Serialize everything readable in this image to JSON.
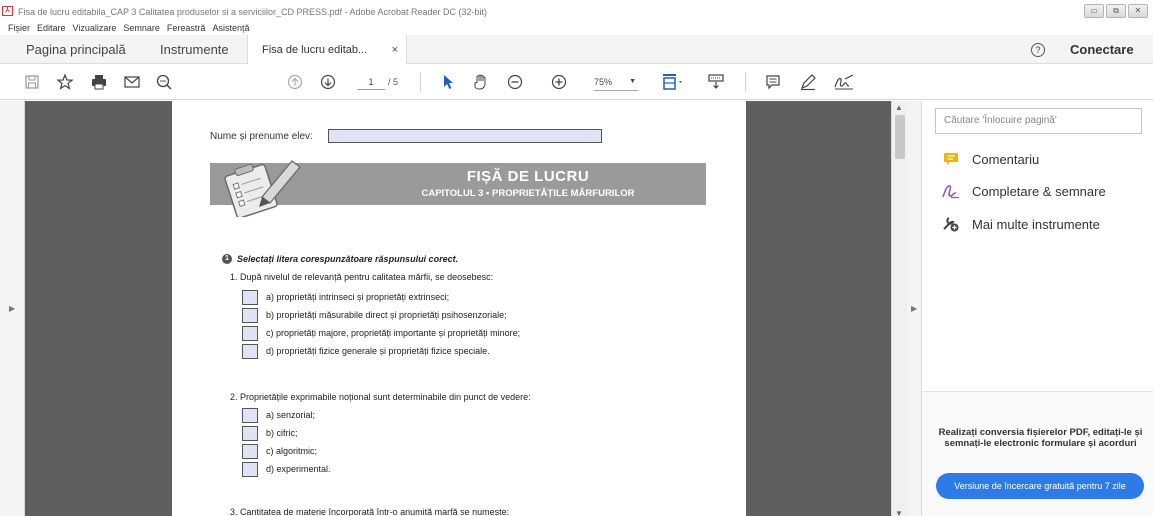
{
  "window": {
    "title": "Fisa de lucru editabila_CAP 3 Calitatea produselor si a serviciilor_CD PRESS.pdf - Adobe Acrobat Reader DC (32-bit)",
    "controls": [
      "minimize",
      "maximize",
      "close"
    ]
  },
  "menu": [
    "Fișier",
    "Editare",
    "Vizualizare",
    "Semnare",
    "Fereastră",
    "Asistență"
  ],
  "tabs": {
    "home": "Pagina principală",
    "tools": "Instrumente",
    "doc": "Fisa de lucru editab...",
    "doc_close": "×"
  },
  "header": {
    "help": "?",
    "connect": "Conectare"
  },
  "toolbar": {
    "icons": [
      "save-icon",
      "bookmark-star-icon",
      "print-icon",
      "email-icon",
      "search-zoom-icon",
      "page-up-icon",
      "page-down-icon",
      "select-arrow-icon",
      "hand-icon",
      "zoom-out-icon",
      "zoom-in-icon",
      "fit-page-icon",
      "scroll-mode-icon",
      "comment-icon",
      "highlight-pen-icon",
      "sign-icon"
    ],
    "page_current": "1",
    "page_total": "/ 5",
    "zoom": "75%",
    "zoom_dropdown": "▼"
  },
  "right_panel": {
    "search_placeholder": "Căutare 'Înlocuire pagină'",
    "items": [
      {
        "label": "Comentariu",
        "icon": "comment-icon",
        "color": "#f5b400"
      },
      {
        "label": "Completare & semnare",
        "icon": "fill-sign-icon",
        "color": "#8a5cc4"
      },
      {
        "label": "Mai multe instrumente",
        "icon": "more-tools-icon",
        "color": "#444444"
      }
    ],
    "promo_text": "Realizați conversia fișierelor PDF, editați-le și semnați-le electronic formulare și acorduri",
    "trial_button": "Versiune de încercare gratuită pentru 7 zile"
  },
  "document": {
    "name_label": "Nume și prenume elev:",
    "banner_title": "FIȘĂ DE LUCRU",
    "banner_subtitle": "CAPITOLUL 3 • PROPRIETĂȚILE MĂRFURILOR",
    "section_number": "1",
    "instruction": "Selectați litera corespunzătoare răspunsului corect.",
    "questions": [
      {
        "text": "1. După nivelul de relevanță pentru calitatea mărfii, se deosebesc:",
        "options": [
          "a) proprietăți intrinseci și proprietăți extrinseci;",
          "b) proprietăți măsurabile direct și proprietăți psihosenzoriale;",
          "c) proprietăți majore, proprietăți importante și proprietăți minore;",
          "d) proprietăți fizice generale și proprietăți fizice speciale."
        ]
      },
      {
        "text": "2. Proprietățile exprimabile noțional sunt determinabile din punct de vedere:",
        "options": [
          "a) senzorial;",
          "b) cifric;",
          "c) algoritmic;",
          "d) experimental."
        ]
      },
      {
        "text": "3. Cantitatea de materie încorporată într-o anumită marfă se numește:",
        "options": []
      }
    ]
  },
  "colors": {
    "doc_background": "#5f5f5f",
    "banner": "#9a9a9a",
    "form_field": "#dfe3f5",
    "accent_blue": "#2d7be6"
  }
}
